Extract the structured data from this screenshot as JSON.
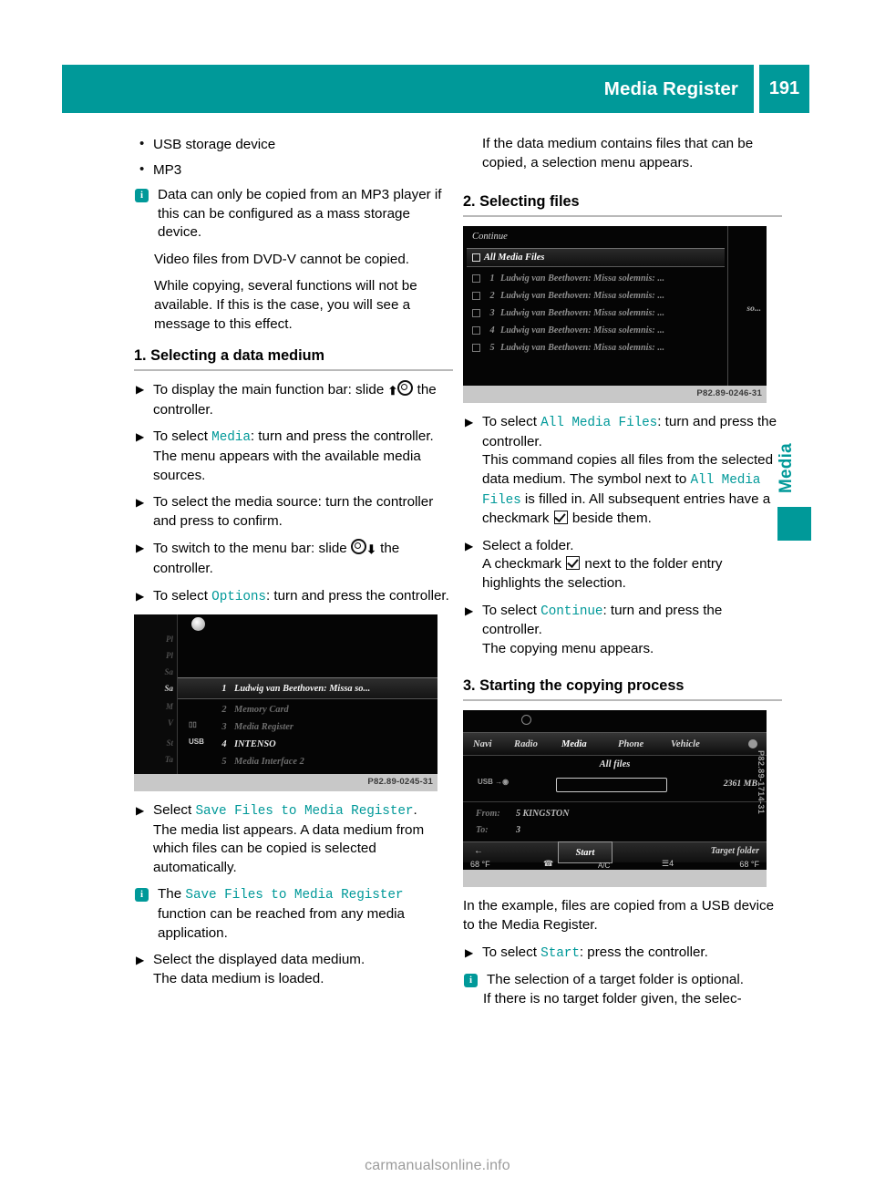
{
  "header": {
    "title": "Media Register",
    "page_number": "191"
  },
  "side_tab": {
    "label": "Media"
  },
  "colors": {
    "accent": "#009999",
    "rule": "#b9b9b9",
    "caption_bar": "#c8c8c8"
  },
  "left_column": {
    "bullets": [
      "USB storage device",
      "MP3"
    ],
    "note1": {
      "icon": "info-icon",
      "lines": [
        "Data can only be copied from an MP3 player if this can be configured as a mass storage device.",
        "Video files from DVD-V cannot be copied.",
        "While copying, several functions will not be available. If this is the case, you will see a message to this effect."
      ]
    },
    "section1": {
      "heading": "1. Selecting a data medium"
    },
    "steps": [
      {
        "pre": "To display the main function bar: slide",
        "glyph": "arrow-up-ring",
        "post": "the controller."
      },
      {
        "pre": "To select",
        "term": "Media",
        "post": ": turn and press the controller.",
        "detail": "The menu appears with the available media sources."
      },
      {
        "pre": "To select the media source: turn the controller and press to confirm."
      },
      {
        "pre": "To switch to the menu bar: slide",
        "glyph": "ring-arrow-down",
        "post": "the controller."
      },
      {
        "pre": "To select",
        "term": "Options",
        "post": ": turn and press the controller."
      }
    ],
    "screenshot1": {
      "caption": "P82.89-0245-31",
      "side_labels": [
        "Pl",
        "Pl",
        "Sa",
        "Sa",
        "M",
        "V",
        "St",
        "Ta"
      ],
      "rows": [
        {
          "num": "1",
          "text": "Ludwig van Beethoven: Missa so...",
          "selected": true
        },
        {
          "num": "2",
          "text": "Memory Card",
          "selected": false
        },
        {
          "num": "3",
          "text": "Media Register",
          "selected": false
        },
        {
          "num": "4",
          "text": "INTENSO",
          "selected": false
        },
        {
          "num": "5",
          "text": "Media Interface 2",
          "selected": false
        }
      ]
    },
    "after_shot": {
      "step_select": {
        "pre": "Select",
        "term": "Save Files to Media Register",
        "post": ".",
        "detail": "The media list appears. A data medium from which files can be copied is selected automatically."
      },
      "note2": {
        "pre": "The",
        "term": "Save Files to Media Register",
        "post": "function can be reached from any media application."
      },
      "step_last": {
        "pre": "Select the displayed data medium.",
        "detail": "The data medium is loaded."
      }
    }
  },
  "right_column": {
    "intro": "If the data medium contains files that can be copied, a selection menu appears.",
    "section2": {
      "heading": "2. Selecting files"
    },
    "screenshot2": {
      "caption": "P82.89-0246-31",
      "continue_label": "Continue",
      "all_media_files": "All Media Files",
      "side_text": "so...",
      "rows": [
        {
          "num": "1",
          "text": "Ludwig van Beethoven: Missa solemnis: ..."
        },
        {
          "num": "2",
          "text": "Ludwig van Beethoven: Missa solemnis: ..."
        },
        {
          "num": "3",
          "text": "Ludwig van Beethoven: Missa solemnis: ..."
        },
        {
          "num": "4",
          "text": "Ludwig van Beethoven: Missa solemnis: ..."
        },
        {
          "num": "5",
          "text": "Ludwig van Beethoven: Missa solemnis: ..."
        }
      ]
    },
    "steps": {
      "s1_pre": "To select",
      "s1_term": "All Media Files",
      "s1_post": ": turn and press the controller.",
      "s1_d1": "This command copies all files from the selected data medium. The symbol next to",
      "s1_term2": "All Media Files",
      "s1_d2": "is filled in. All subsequent entries have a checkmark",
      "s1_d3": "beside them.",
      "s2_pre": "Select a folder.",
      "s2_d1": "A checkmark",
      "s2_d2": "next to the folder entry highlights the selection.",
      "s3_pre": "To select",
      "s3_term": "Continue",
      "s3_post": ": turn and press the controller.",
      "s3_detail": "The copying menu appears."
    },
    "section3": {
      "heading": "3. Starting the copying process"
    },
    "screenshot3": {
      "caption": "P82.89-1714-31",
      "menu": [
        "Navi",
        "Radio",
        "Media",
        "Phone",
        "Vehicle"
      ],
      "title": "All files",
      "size": "2361 MB",
      "from_label": "From:",
      "from_value": "5",
      "from_device": "KINGSTON",
      "to_label": "To:",
      "to_value": "3",
      "start_label": "Start",
      "target_folder_label": "Target folder",
      "temp_left": "68 °F",
      "temp_right": "68 °F",
      "fan": "4",
      "ac": "A/C"
    },
    "closing": {
      "para": "In the example, files are copied from a USB device to the Media Register.",
      "step_pre": "To select",
      "step_term": "Start",
      "step_post": ": press the controller.",
      "note_line1": "The selection of a target folder is optional.",
      "note_line2": "If there is no target folder given, the selec-"
    }
  },
  "footer": {
    "watermark": "carmanualsonline.info"
  }
}
